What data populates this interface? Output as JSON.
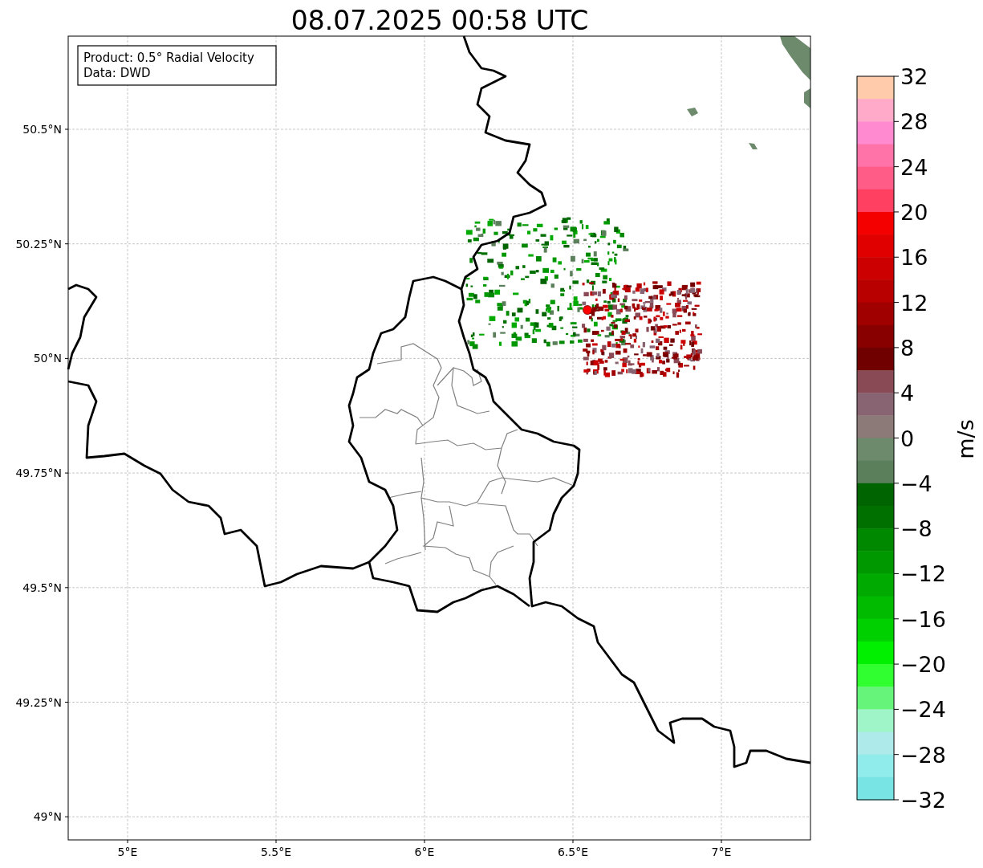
{
  "title": "08.07.2025 00:58 UTC",
  "legend": [
    "Product: 0.5° Radial Velocity",
    "Data: DWD"
  ],
  "map": {
    "xticks": [
      "5°E",
      "5.5°E",
      "6°E",
      "6.5°E",
      "7°E"
    ],
    "yticks": [
      "50.5°N",
      "50.25°N",
      "50°N",
      "49.75°N",
      "49.5°N",
      "49.25°N",
      "49°N"
    ]
  },
  "colorbar": {
    "label": "m/s",
    "ticks": [
      "32",
      "28",
      "24",
      "20",
      "16",
      "12",
      "8",
      "4",
      "0",
      "−4",
      "−8",
      "−12",
      "−16",
      "−20",
      "−24",
      "−28",
      "−32"
    ],
    "bands": [
      {
        "color": "#ffcbaa"
      },
      {
        "color": "#ffaac8"
      },
      {
        "color": "#ff8ad0"
      },
      {
        "color": "#ff73a8"
      },
      {
        "color": "#ff5c88"
      },
      {
        "color": "#ff4060"
      },
      {
        "color": "#f50000"
      },
      {
        "color": "#e00000"
      },
      {
        "color": "#cc0000"
      },
      {
        "color": "#b80000"
      },
      {
        "color": "#a00000"
      },
      {
        "color": "#880000"
      },
      {
        "color": "#700000"
      },
      {
        "color": "#8a4a55"
      },
      {
        "color": "#886472"
      },
      {
        "color": "#8c7a78"
      },
      {
        "color": "#6d8a6d"
      },
      {
        "color": "#5a7f5a"
      },
      {
        "color": "#006400"
      },
      {
        "color": "#007000"
      },
      {
        "color": "#008800"
      },
      {
        "color": "#009800"
      },
      {
        "color": "#00aa00"
      },
      {
        "color": "#00bb00"
      },
      {
        "color": "#00d000"
      },
      {
        "color": "#00f000"
      },
      {
        "color": "#30ff30"
      },
      {
        "color": "#66f57a"
      },
      {
        "color": "#9ff5c8"
      },
      {
        "color": "#aeeaea"
      },
      {
        "color": "#90ebeb"
      },
      {
        "color": "#78e4e4"
      }
    ]
  }
}
